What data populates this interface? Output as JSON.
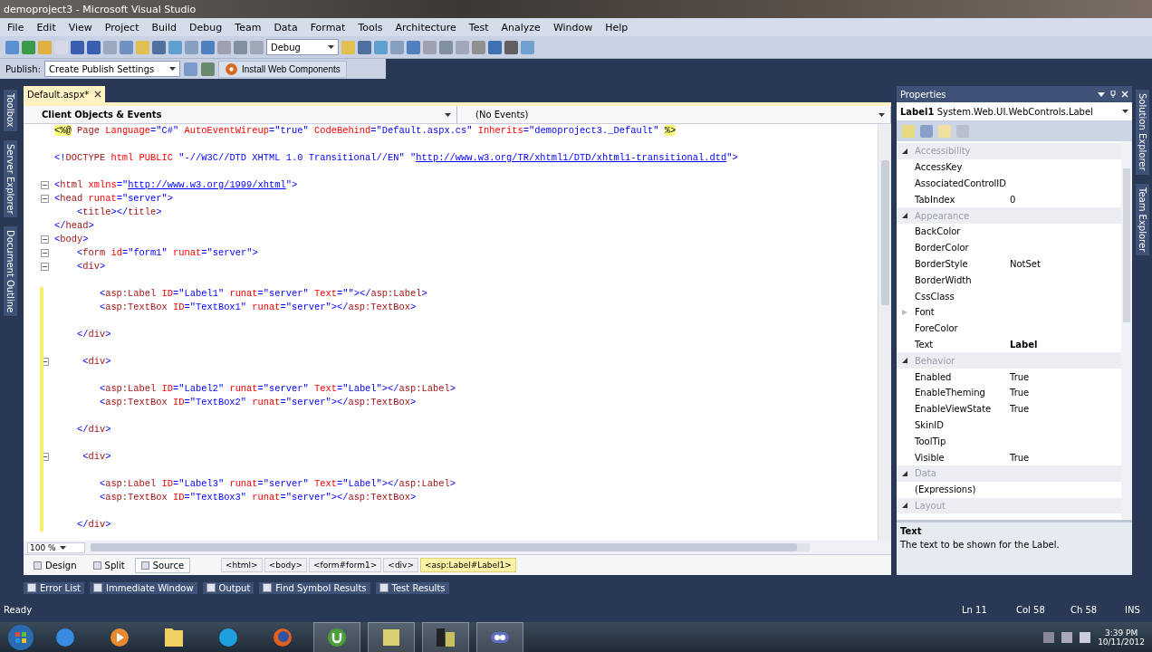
{
  "window": {
    "title": "demoproject3 - Microsoft Visual Studio"
  },
  "menu": [
    "File",
    "Edit",
    "View",
    "Project",
    "Build",
    "Debug",
    "Team",
    "Data",
    "Format",
    "Tools",
    "Architecture",
    "Test",
    "Analyze",
    "Window",
    "Help"
  ],
  "toolbar": {
    "configuration": "Debug"
  },
  "publish_toolbar": {
    "label": "Publish:",
    "profile": "Create Publish Settings",
    "install_button": "Install Web Components"
  },
  "left_dock": [
    "Toolbox",
    "Server Explorer",
    "Document Outline"
  ],
  "right_dock": [
    "Solution Explorer",
    "Team Explorer"
  ],
  "editor": {
    "tabs": [
      {
        "label": "Default.aspx*",
        "selected": true
      }
    ],
    "object_dropdown": "Client Objects & Events",
    "event_dropdown": "(No Events)",
    "lines": [
      {
        "kind": "code",
        "text": "<%@ Page Language=\"C#\" AutoEventWireup=\"true\" CodeBehind=\"Default.aspx.cs\" Inherits=\"demoproject3._Default\" %>",
        "foldable": false,
        "changed": false
      },
      {
        "kind": "blank",
        "changed": false
      },
      {
        "kind": "code",
        "text": "<!DOCTYPE html PUBLIC \"-//W3C//DTD XHTML 1.0 Transitional//EN\" \"http://www.w3.org/TR/xhtml1/DTD/xhtml1-transitional.dtd\">",
        "foldable": false,
        "changed": false
      },
      {
        "kind": "blank",
        "changed": false
      },
      {
        "kind": "code",
        "text": "<html xmlns=\"http://www.w3.org/1999/xhtml\">",
        "foldable": true,
        "changed": false
      },
      {
        "kind": "code",
        "text": "<head runat=\"server\">",
        "foldable": true,
        "changed": false
      },
      {
        "kind": "code",
        "text": "    <title></title>",
        "foldable": false,
        "changed": false
      },
      {
        "kind": "code",
        "text": "</head>",
        "foldable": false,
        "changed": false
      },
      {
        "kind": "code",
        "text": "<body>",
        "foldable": true,
        "changed": false
      },
      {
        "kind": "code",
        "text": "    <form id=\"form1\" runat=\"server\">",
        "foldable": true,
        "changed": false
      },
      {
        "kind": "code",
        "text": "    <div>",
        "foldable": true,
        "changed": false
      },
      {
        "kind": "blank",
        "changed": false
      },
      {
        "kind": "code",
        "text": "        <asp:Label ID=\"Label1\" runat=\"server\" Text=\"\"></asp:Label>",
        "foldable": false,
        "changed": true
      },
      {
        "kind": "code",
        "text": "        <asp:TextBox ID=\"TextBox1\" runat=\"server\"></asp:TextBox>",
        "foldable": false,
        "changed": true
      },
      {
        "kind": "blank",
        "changed": true
      },
      {
        "kind": "code",
        "text": "    </div>",
        "foldable": false,
        "changed": true
      },
      {
        "kind": "blank",
        "changed": true
      },
      {
        "kind": "code",
        "text": "     <div>",
        "foldable": true,
        "changed": true
      },
      {
        "kind": "blank",
        "changed": true
      },
      {
        "kind": "code",
        "text": "        <asp:Label ID=\"Label2\" runat=\"server\" Text=\"Label\"></asp:Label>",
        "foldable": false,
        "changed": true
      },
      {
        "kind": "code",
        "text": "        <asp:TextBox ID=\"TextBox2\" runat=\"server\"></asp:TextBox>",
        "foldable": false,
        "changed": true
      },
      {
        "kind": "blank",
        "changed": true
      },
      {
        "kind": "code",
        "text": "    </div>",
        "foldable": false,
        "changed": true
      },
      {
        "kind": "blank",
        "changed": true
      },
      {
        "kind": "code",
        "text": "     <div>",
        "foldable": true,
        "changed": true
      },
      {
        "kind": "blank",
        "changed": true
      },
      {
        "kind": "code",
        "text": "        <asp:Label ID=\"Label3\" runat=\"server\" Text=\"Label\"></asp:Label>",
        "foldable": false,
        "changed": true
      },
      {
        "kind": "code",
        "text": "        <asp:TextBox ID=\"TextBox3\" runat=\"server\"></asp:TextBox>",
        "foldable": false,
        "changed": true
      },
      {
        "kind": "blank",
        "changed": true
      },
      {
        "kind": "code",
        "text": "    </div>",
        "foldable": false,
        "changed": true
      }
    ],
    "zoom": "100 %",
    "view_tabs": [
      {
        "label": "Design",
        "selected": false
      },
      {
        "label": "Split",
        "selected": false
      },
      {
        "label": "Source",
        "selected": true
      }
    ],
    "breadcrumbs": [
      {
        "label": "<html>",
        "selected": false
      },
      {
        "label": "<body>",
        "selected": false
      },
      {
        "label": "<form#form1>",
        "selected": false
      },
      {
        "label": "<div>",
        "selected": false
      },
      {
        "label": "<asp:Label#Label1>",
        "selected": true
      }
    ]
  },
  "properties": {
    "title": "Properties",
    "object": "Label1",
    "object_type": "System.Web.UI.WebControls.Label",
    "rows": [
      {
        "kind": "category",
        "name": "Accessibility"
      },
      {
        "kind": "property",
        "name": "AccessKey"
      },
      {
        "kind": "property",
        "name": "AssociatedControlID"
      },
      {
        "kind": "property",
        "name": "TabIndex",
        "value": "0",
        "modified": false
      },
      {
        "kind": "category",
        "name": "Appearance"
      },
      {
        "kind": "property",
        "name": "BackColor"
      },
      {
        "kind": "property",
        "name": "BorderColor"
      },
      {
        "kind": "property",
        "name": "BorderStyle",
        "value": "NotSet",
        "modified": false
      },
      {
        "kind": "property",
        "name": "BorderWidth"
      },
      {
        "kind": "property",
        "name": "CssClass"
      },
      {
        "kind": "property",
        "name": "Font",
        "expandable": true
      },
      {
        "kind": "property",
        "name": "ForeColor"
      },
      {
        "kind": "property",
        "name": "Text",
        "value": "Label",
        "modified": true
      },
      {
        "kind": "category",
        "name": "Behavior"
      },
      {
        "kind": "property",
        "name": "Enabled",
        "value": "True",
        "modified": false
      },
      {
        "kind": "property",
        "name": "EnableTheming",
        "value": "True",
        "modified": false
      },
      {
        "kind": "property",
        "name": "EnableViewState",
        "value": "True",
        "modified": false
      },
      {
        "kind": "property",
        "name": "SkinID"
      },
      {
        "kind": "property",
        "name": "ToolTip"
      },
      {
        "kind": "property",
        "name": "Visible",
        "value": "True",
        "modified": false
      },
      {
        "kind": "category",
        "name": "Data"
      },
      {
        "kind": "property",
        "name": "(Expressions)"
      },
      {
        "kind": "category",
        "name": "Layout"
      }
    ],
    "description_title": "Text",
    "description": "The text to be shown for the Label."
  },
  "tool_tabs": [
    "Error List",
    "Immediate Window",
    "Output",
    "Find Symbol Results",
    "Test Results"
  ],
  "status_bar": {
    "message": "Ready",
    "line": "Ln 11",
    "column": "Col 58",
    "char": "Ch 58",
    "mode": "INS"
  },
  "taskbar": {
    "apps": [
      {
        "kind": "browser",
        "running": false
      },
      {
        "kind": "media",
        "running": false
      },
      {
        "kind": "folder",
        "running": false
      },
      {
        "kind": "chat",
        "running": false
      },
      {
        "kind": "fox",
        "running": false
      },
      {
        "kind": "torrent",
        "running": true
      },
      {
        "kind": "notes",
        "running": true
      },
      {
        "kind": "tool",
        "running": true
      },
      {
        "kind": "studio",
        "running": true
      }
    ],
    "time": "3:39 PM",
    "date": "10/11/2012"
  }
}
